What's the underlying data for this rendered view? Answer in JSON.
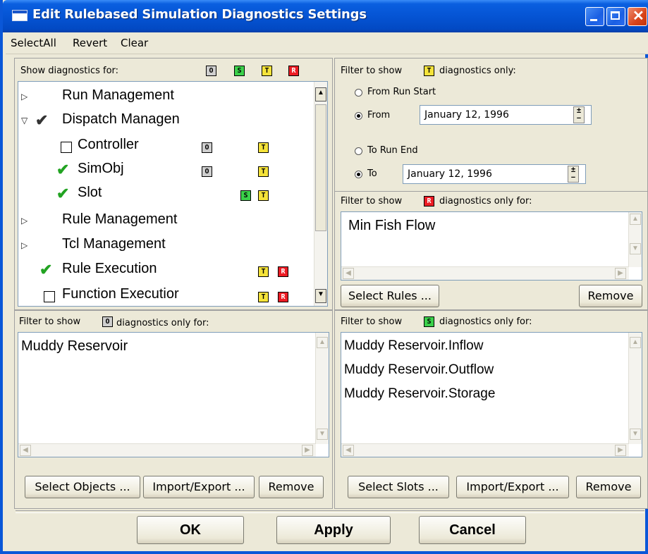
{
  "window": {
    "title": "Edit Rulebased Simulation Diagnostics Settings"
  },
  "menu": {
    "select_all": "SelectAll",
    "revert": "Revert",
    "clear": "Clear"
  },
  "show_panel": {
    "label": "Show diagnostics for:",
    "header_badges": [
      "O",
      "S",
      "T",
      "R"
    ],
    "tree": [
      {
        "label": "Run Management",
        "state": "collapsed"
      },
      {
        "label": "Dispatch Managen",
        "state": "expanded",
        "check": "partial"
      },
      {
        "label": "Controller",
        "check": "none",
        "badges": [
          "O",
          "T"
        ]
      },
      {
        "label": "SimObj",
        "check": "checked",
        "badges": [
          "O",
          "T"
        ]
      },
      {
        "label": "Slot",
        "check": "checked",
        "badges": [
          "S",
          "T"
        ]
      },
      {
        "label": "Rule Management",
        "state": "collapsed"
      },
      {
        "label": "Tcl Management",
        "state": "collapsed"
      },
      {
        "label": "Rule Execution",
        "check": "checked",
        "badges": [
          "T",
          "R"
        ]
      },
      {
        "label": "Function Executior",
        "check": "none",
        "badges": [
          "T",
          "R"
        ]
      }
    ]
  },
  "timestep_filter": {
    "label_prefix": "Filter to show",
    "badge": "T",
    "label_suffix": "diagnostics only:",
    "from_run_start": "From Run Start",
    "from": "From",
    "from_date": "January 12, 1996",
    "to_run_end": "To Run End",
    "to": "To",
    "to_date": "January 12, 1996",
    "selected_start": "From",
    "selected_end": "To"
  },
  "rule_filter": {
    "label_prefix": "Filter to show",
    "badge": "R",
    "label_suffix": "diagnostics only for:",
    "items": [
      "Min Fish Flow"
    ],
    "select_button": "Select Rules ...",
    "remove_button": "Remove"
  },
  "object_filter": {
    "label_prefix": "Filter to show",
    "badge": "O",
    "label_suffix": "diagnostics only for:",
    "items": [
      "Muddy Reservoir"
    ],
    "select_button": "Select Objects ...",
    "import_button": "Import/Export ...",
    "remove_button": "Remove"
  },
  "slot_filter": {
    "label_prefix": "Filter to show",
    "badge": "S",
    "label_suffix": "diagnostics only for:",
    "items": [
      "Muddy Reservoir.Inflow",
      "Muddy Reservoir.Outflow",
      "Muddy Reservoir.Storage"
    ],
    "select_button": "Select Slots ...",
    "import_button": "Import/Export ...",
    "remove_button": "Remove"
  },
  "footer": {
    "ok": "OK",
    "apply": "Apply",
    "cancel": "Cancel"
  }
}
